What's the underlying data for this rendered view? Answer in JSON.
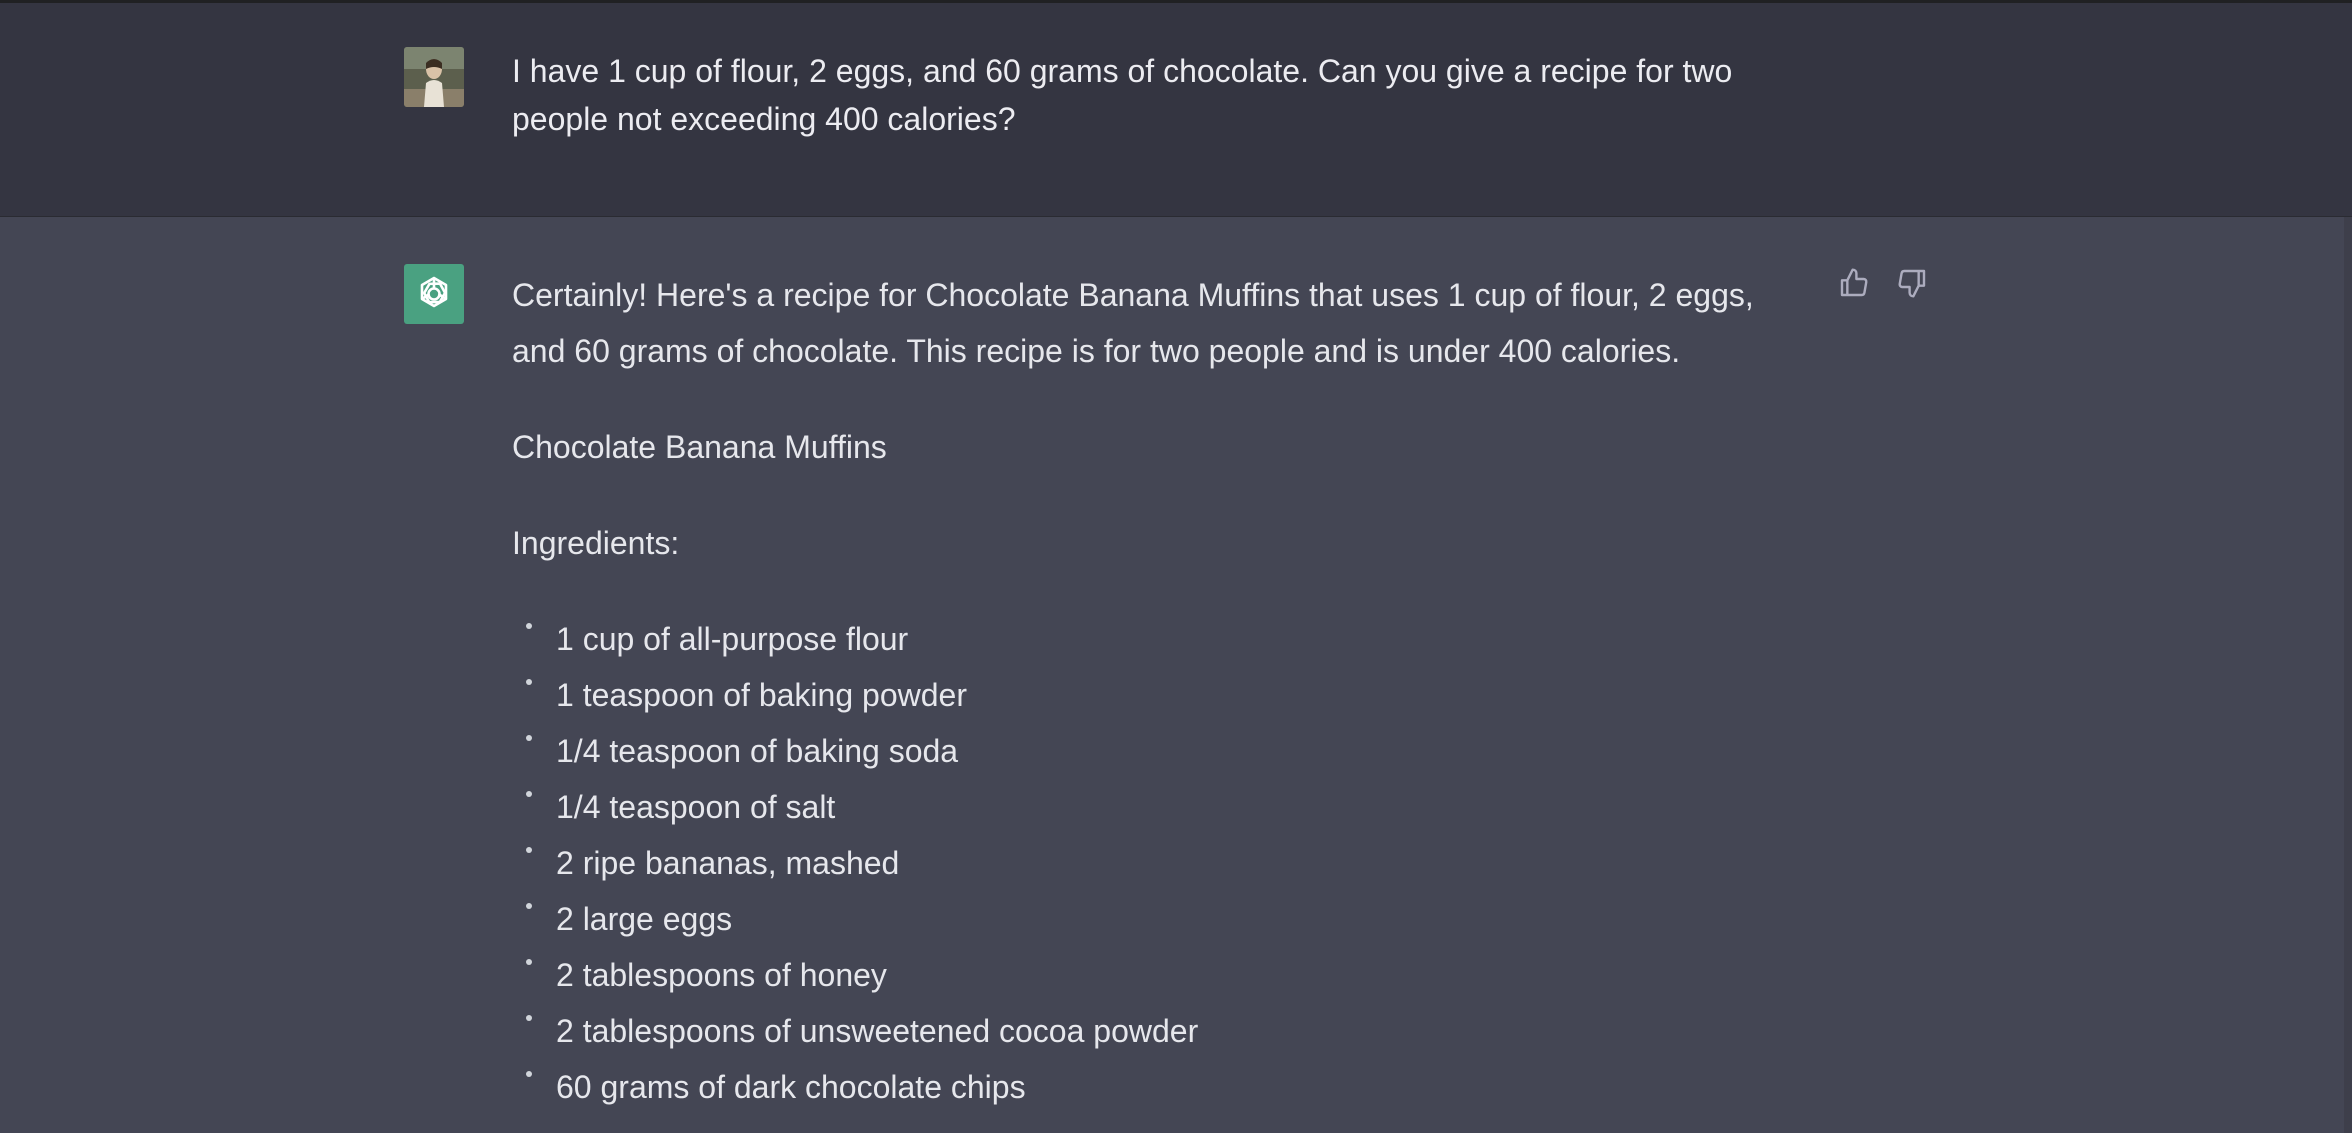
{
  "user_message": {
    "text_line1": "I have 1 cup of flour, 2 eggs, and 60 grams of chocolate. Can you give a recipe for two",
    "text_line2": "people not exceeding 400 calories?"
  },
  "assistant_message": {
    "intro_line1": "Certainly! Here's a recipe for Chocolate Banana Muffins that uses 1 cup of flour, 2 eggs,",
    "intro_line2": "and 60 grams of chocolate. This recipe is for two people and is under 400 calories.",
    "recipe_title": "Chocolate Banana Muffins",
    "ingredients_label": "Ingredients:",
    "ingredients": [
      "1 cup of all-purpose flour",
      "1 teaspoon of baking powder",
      "1/4 teaspoon of baking soda",
      "1/4 teaspoon of salt",
      "2 ripe bananas, mashed",
      "2 large eggs",
      "2 tablespoons of honey",
      "2 tablespoons of unsweetened cocoa powder",
      "60 grams of dark chocolate chips"
    ]
  },
  "icons": {
    "user_avatar": "user-avatar-photo",
    "bot_avatar": "openai-logo-icon",
    "thumbs_up": "thumbs-up-icon",
    "thumbs_down": "thumbs-down-icon"
  },
  "colors": {
    "user_bg": "#343541",
    "assistant_bg": "#444654",
    "bot_avatar_bg": "#4aa181",
    "text": "#ececf1"
  }
}
